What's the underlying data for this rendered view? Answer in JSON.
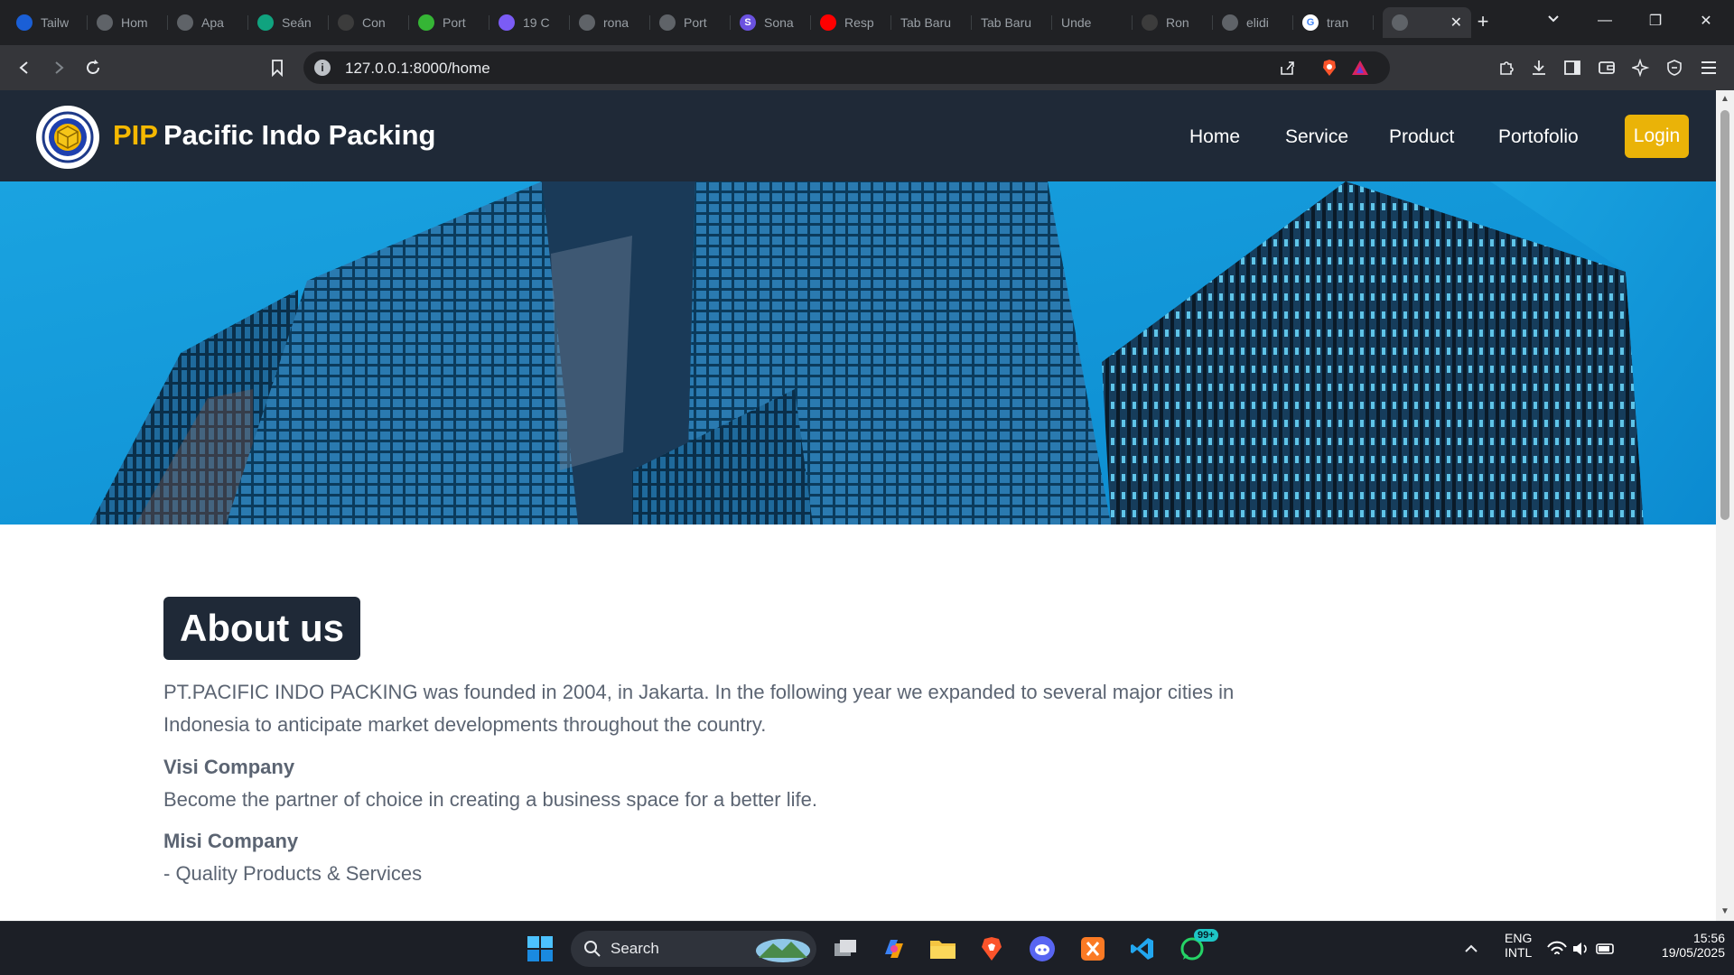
{
  "browser": {
    "tabs": [
      {
        "label": "Tailw",
        "fav_color": "#1a5fd6",
        "fav_glyph": ""
      },
      {
        "label": "Hom",
        "fav_color": "#5f6368",
        "fav_glyph": ""
      },
      {
        "label": "Apa",
        "fav_color": "#5f6368",
        "fav_glyph": ""
      },
      {
        "label": "Seán",
        "fav_color": "#10a37f",
        "fav_glyph": ""
      },
      {
        "label": "Con",
        "fav_color": "#3c3c3c",
        "fav_glyph": ""
      },
      {
        "label": "Port",
        "fav_color": "#35b535",
        "fav_glyph": ""
      },
      {
        "label": "19 C",
        "fav_color": "#7b5cf5",
        "fav_glyph": ""
      },
      {
        "label": "rona",
        "fav_color": "#5f6368",
        "fav_glyph": ""
      },
      {
        "label": "Port",
        "fav_color": "#5f6368",
        "fav_glyph": ""
      },
      {
        "label": "Sona",
        "fav_color": "#6b52e0",
        "fav_glyph": "S"
      },
      {
        "label": "Resp",
        "fav_color": "#ff0000",
        "fav_glyph": ""
      },
      {
        "label": "Tab Baru",
        "fav_color": "",
        "fav_glyph": ""
      },
      {
        "label": "Tab Baru",
        "fav_color": "",
        "fav_glyph": ""
      },
      {
        "label": "Unde",
        "fav_color": "",
        "fav_glyph": ""
      },
      {
        "label": "Ron",
        "fav_color": "#3c3c3c",
        "fav_glyph": ""
      },
      {
        "label": "elidi",
        "fav_color": "#5f6368",
        "fav_glyph": ""
      },
      {
        "label": "tran",
        "fav_color": "#ffffff",
        "fav_glyph": "G"
      }
    ],
    "address": "127.0.0.1:8000/home"
  },
  "site": {
    "brand_accent": "PIP",
    "brand_name": "Pacific Indo Packing",
    "nav": [
      "Home",
      "Service",
      "Product",
      "Portofolio"
    ],
    "login": "Login",
    "colors": {
      "header": "#1f2937",
      "accent": "#f5b800",
      "login": "#eab308"
    }
  },
  "about": {
    "title": "About us",
    "intro": "PT.PACIFIC INDO PACKING was founded in 2004, in Jakarta. In the following year we expanded to several major cities in Indonesia to anticipate market developments throughout the country.",
    "visi_heading": "Visi Company",
    "visi_text": "Become the partner of choice in creating a business space for a better life.",
    "misi_heading": "Misi Company",
    "misi_item": "- Quality Products & Services"
  },
  "taskbar": {
    "search": "Search",
    "whatsapp_badge": "99+",
    "lang": "ENG",
    "layout": "INTL",
    "time": "15:56",
    "date": "19/05/2025"
  }
}
